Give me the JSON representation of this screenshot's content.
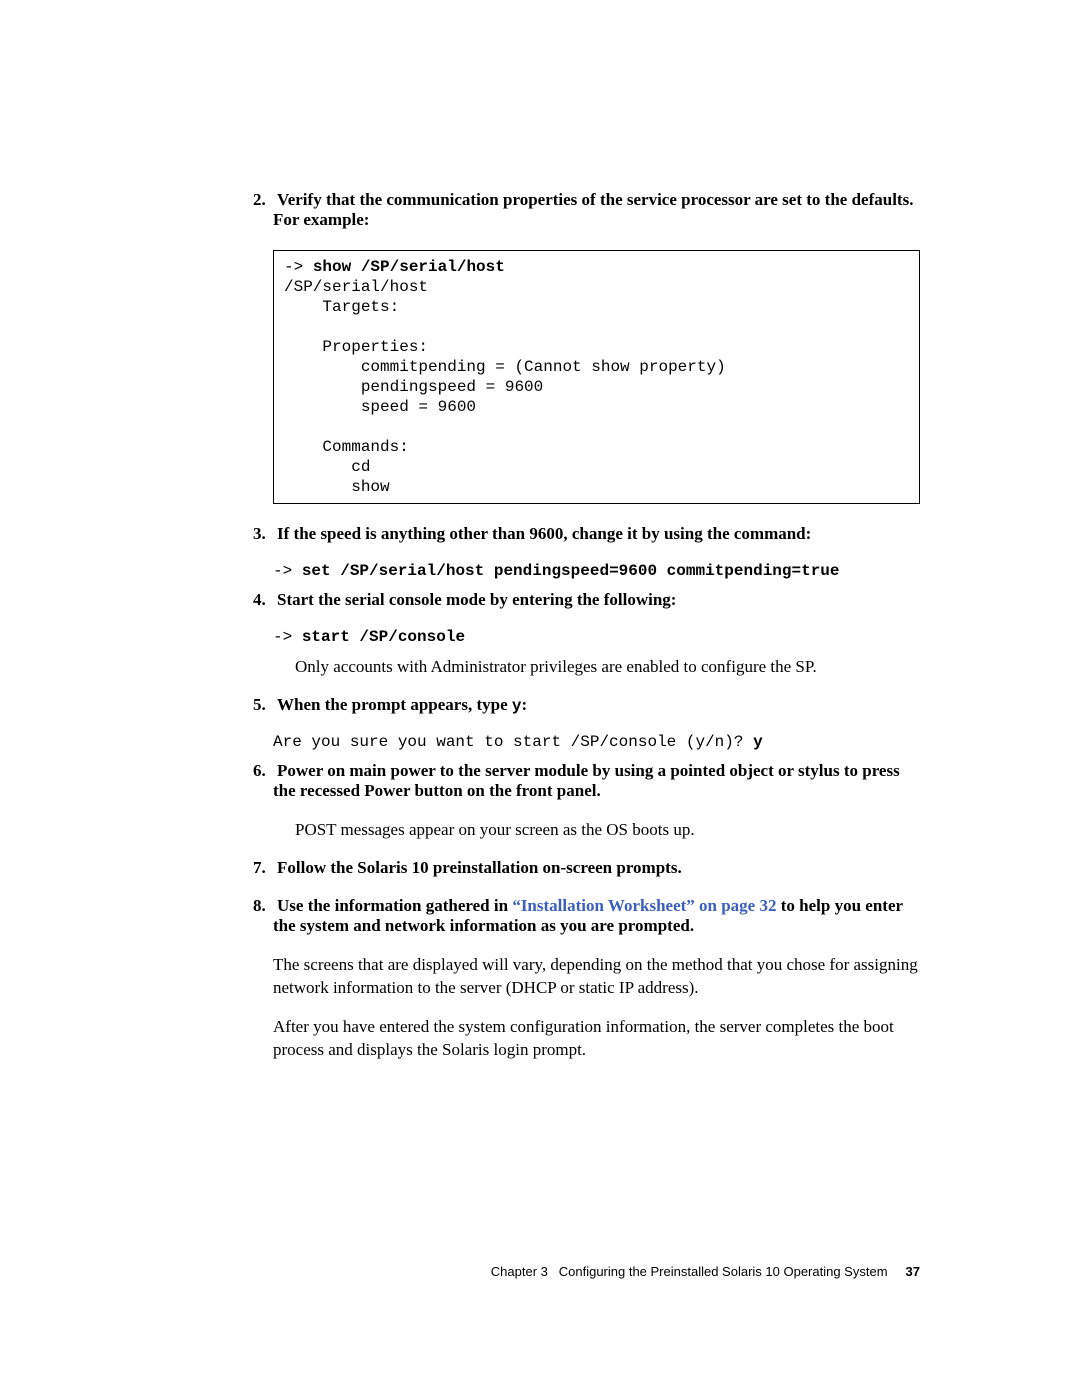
{
  "steps": {
    "s2": {
      "num": "2.",
      "text": "Verify that the communication properties of the service processor are set to the defaults. For example:"
    },
    "s3": {
      "num": "3.",
      "text": "If the speed is anything other than 9600, change it by using the command:",
      "cmd_prefix": "-> ",
      "cmd": "set /SP/serial/host pendingspeed=9600 commitpending=true"
    },
    "s4": {
      "num": "4.",
      "text": "Start the serial console mode by entering the following:",
      "cmd_prefix": "-> ",
      "cmd": "start /SP/console",
      "after": "Only accounts with Administrator privileges are enabled to configure the SP."
    },
    "s5": {
      "num": "5.",
      "text_a": "When the prompt appears, type ",
      "text_b": "y",
      "text_c": ":",
      "output": "Are you sure you want to start /SP/console (y/n)? ",
      "input": "y"
    },
    "s6": {
      "num": "6.",
      "text": "Power on main power to the server module by using a pointed object or stylus to press the recessed Power button on the front panel.",
      "after": "POST messages appear on your screen as the OS boots up."
    },
    "s7": {
      "num": "7.",
      "text": "Follow the Solaris 10 preinstallation on-screen prompts."
    },
    "s8": {
      "num": "8.",
      "text_a": "Use the information gathered in ",
      "link": "“Installation Worksheet” on page 32",
      "text_b": " to help you enter the system and network information as you are prompted."
    }
  },
  "codebox": {
    "prefix": "-> ",
    "cmd": "show /SP/serial/host",
    "body": "/SP/serial/host\n    Targets:\n\n    Properties:\n        commitpending = (Cannot show property)\n        pendingspeed = 9600\n        speed = 9600\n\n    Commands:\n       cd\n       show"
  },
  "para1": "The screens that are displayed will vary, depending on the method that you chose for assigning network information to the server (DHCP or static IP address).",
  "para2": "After you have entered the system configuration information, the server completes the boot process and displays the Solaris login prompt.",
  "footer": {
    "chapter": "Chapter 3",
    "title": "Configuring the Preinstalled Solaris 10 Operating System",
    "page": "37"
  }
}
